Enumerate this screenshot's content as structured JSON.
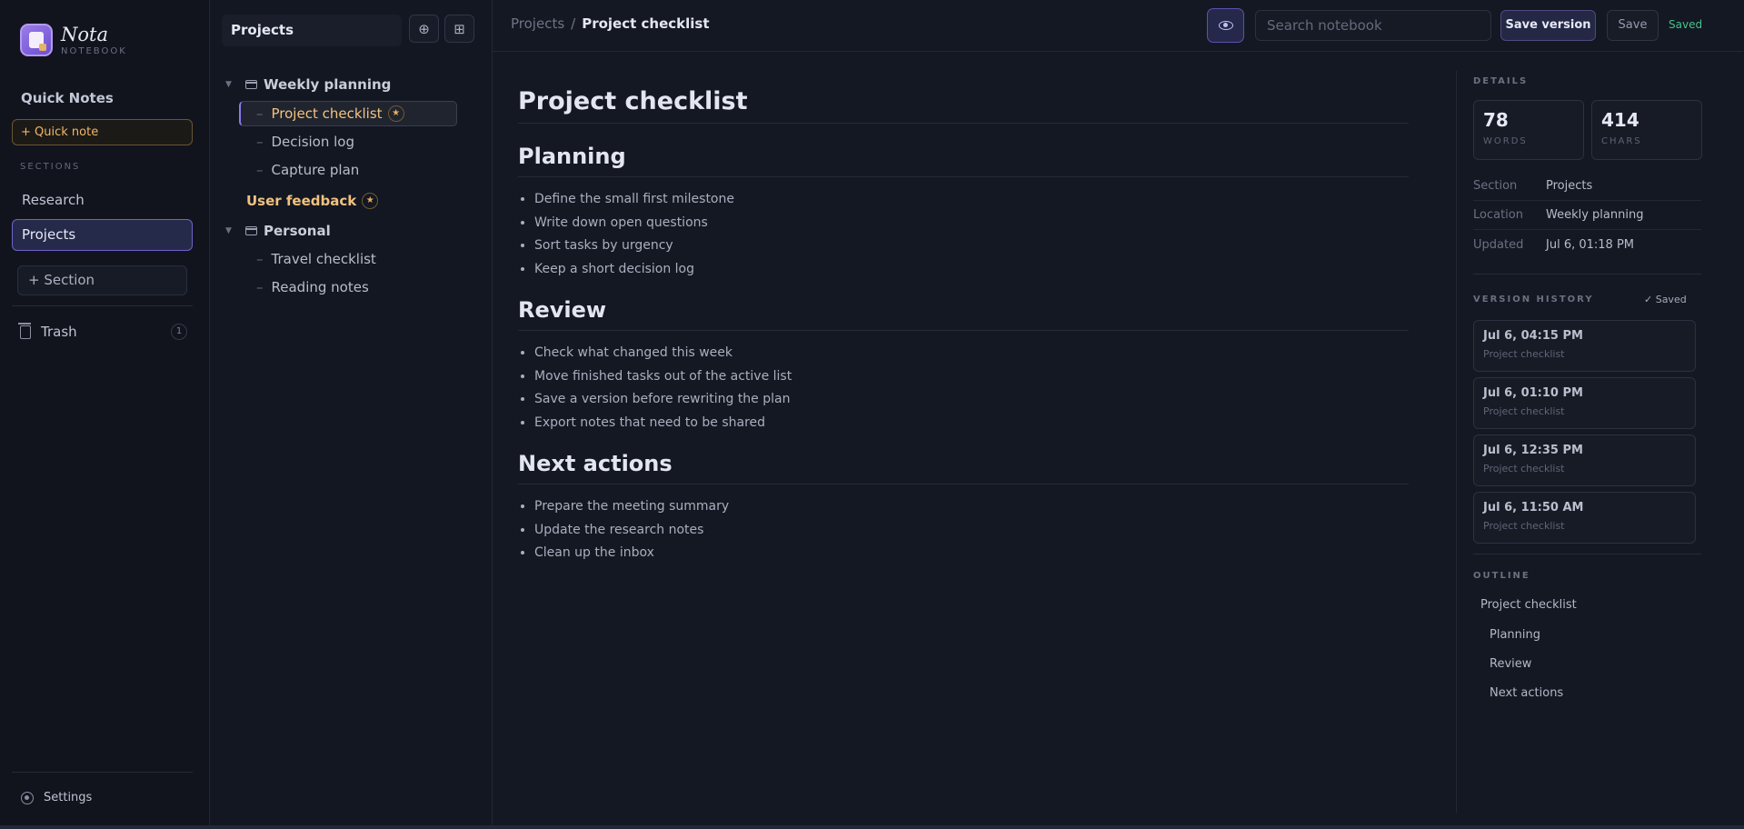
{
  "brand": {
    "name": "Nota",
    "subtitle": "NOTEBOOK"
  },
  "sidebar": {
    "quick_notes_title": "Quick Notes",
    "quick_note_button": "+ Quick note",
    "sections_label": "SECTIONS",
    "sections": [
      {
        "label": "Research",
        "active": false
      },
      {
        "label": "Projects",
        "active": true
      }
    ],
    "add_section_button": "+ Section",
    "trash": {
      "label": "Trash",
      "count": "1"
    },
    "settings_label": "Settings"
  },
  "tree": {
    "title": "Projects",
    "folders": [
      {
        "label": "Weekly planning",
        "notes": [
          {
            "label": "Project checklist",
            "starred": true,
            "active": true
          },
          {
            "label": "Decision log"
          },
          {
            "label": "Capture plan"
          }
        ]
      },
      {
        "label": "User feedback",
        "starred": true,
        "type": "note"
      },
      {
        "label": "Personal",
        "notes": [
          {
            "label": "Travel checklist"
          },
          {
            "label": "Reading notes"
          }
        ]
      }
    ],
    "star_glyph": "★"
  },
  "topbar": {
    "breadcrumb_root": "Projects",
    "breadcrumb_sep": "/",
    "breadcrumb_current": "Project checklist",
    "search_placeholder": "Search notebook",
    "save_version_label": "Save version",
    "save_label": "Save",
    "status": "Saved"
  },
  "document": {
    "title": "Project checklist",
    "sections": [
      {
        "heading": "Planning",
        "items": [
          "Define the small first milestone",
          "Write down open questions",
          "Sort tasks by urgency",
          "Keep a short decision log"
        ]
      },
      {
        "heading": "Review",
        "items": [
          "Check what changed this week",
          "Move finished tasks out of the active list",
          "Save a version before rewriting the plan",
          "Export notes that need to be shared"
        ]
      },
      {
        "heading": "Next actions",
        "items": [
          "Prepare the meeting summary",
          "Update the research notes",
          "Clean up the inbox"
        ]
      }
    ]
  },
  "details": {
    "label": "DETAILS",
    "words": {
      "value": "78",
      "label": "WORDS"
    },
    "chars": {
      "value": "414",
      "label": "CHARS"
    },
    "meta": [
      {
        "key": "Section",
        "value": "Projects"
      },
      {
        "key": "Location",
        "value": "Weekly planning"
      },
      {
        "key": "Updated",
        "value": "Jul 6, 01:18 PM"
      }
    ]
  },
  "version_history": {
    "label": "VERSION HISTORY",
    "status": "✓ Saved",
    "versions": [
      {
        "time": "Jul 6, 04:15 PM",
        "name": "Project checklist"
      },
      {
        "time": "Jul 6, 01:10 PM",
        "name": "Project checklist"
      },
      {
        "time": "Jul 6, 12:35 PM",
        "name": "Project checklist"
      },
      {
        "time": "Jul 6, 11:50 AM",
        "name": "Project checklist"
      }
    ]
  },
  "outline": {
    "label": "OUTLINE",
    "items": [
      {
        "label": "Project checklist",
        "level": 1
      },
      {
        "label": "Planning",
        "level": 2
      },
      {
        "label": "Review",
        "level": 2
      },
      {
        "label": "Next actions",
        "level": 2
      }
    ]
  },
  "colors": {
    "accent": "#6e62c8",
    "star": "#e9ad5c",
    "saved": "#47c28a"
  }
}
